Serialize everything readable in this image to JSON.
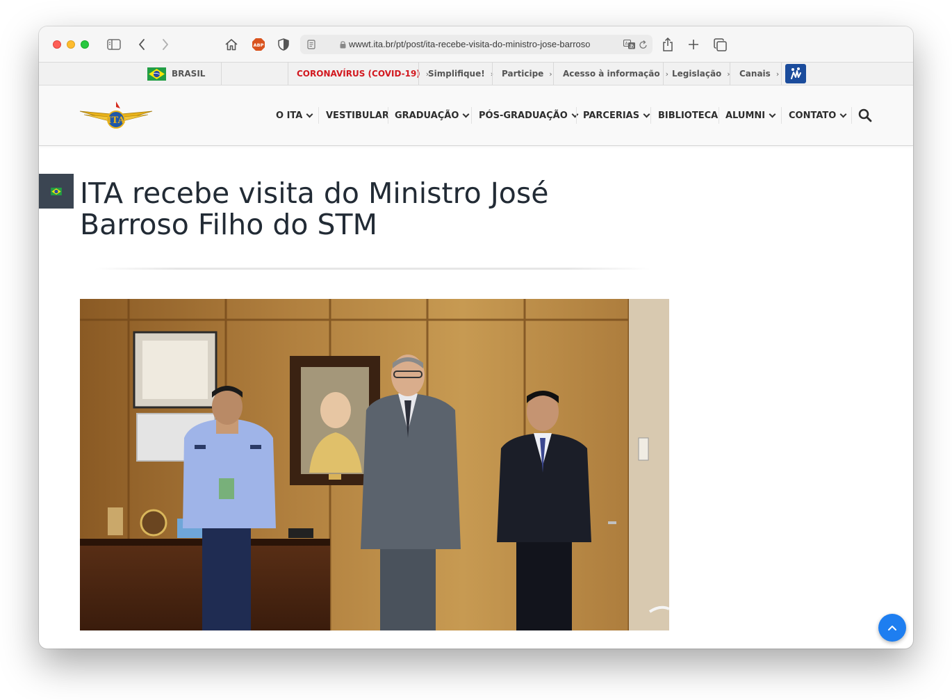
{
  "browser": {
    "url": "wwwt.ita.br/pt/post/ita-recebe-visita-do-ministro-jose-barroso",
    "abp_label": "ABP"
  },
  "govbar": {
    "country": "BRASIL",
    "links": [
      "CORONAVÍRUS (COVID-19)",
      "Simplifique!",
      "Participe",
      "Acesso à informação",
      "Legislação",
      "Canais"
    ],
    "highlight_color": "#d2181f"
  },
  "site": {
    "logo_text": "ITA",
    "nav": [
      "O ITA",
      "VESTIBULAR",
      "GRADUAÇÃO",
      "PÓS-GRADUAÇÃO",
      "PARCERIAS",
      "BIBLIOTECA",
      "ALUMNI",
      "CONTATO"
    ]
  },
  "article": {
    "title": "ITA recebe visita do Ministro José Barroso Filho do STM"
  },
  "colors": {
    "accent": "#1e7ef0",
    "flag_tab": "#3b4552",
    "title_text": "#222b35"
  }
}
